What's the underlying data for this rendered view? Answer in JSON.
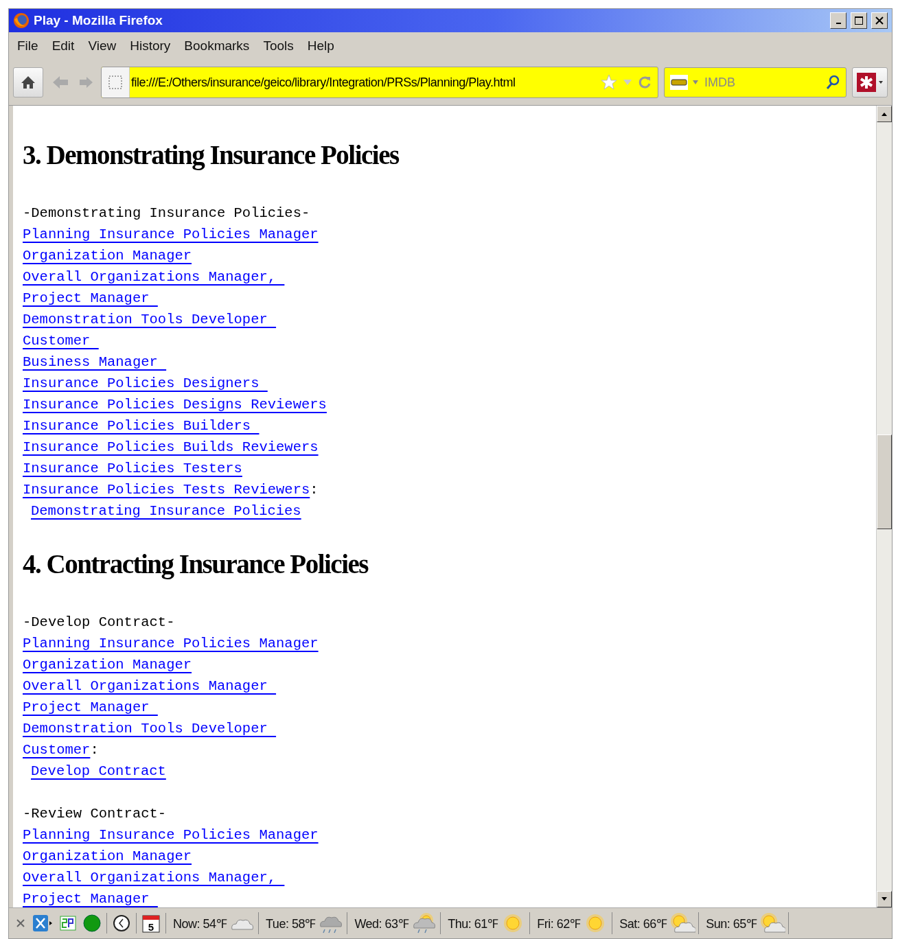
{
  "window": {
    "title": "Play - Mozilla Firefox"
  },
  "menu": [
    "File",
    "Edit",
    "View",
    "History",
    "Bookmarks",
    "Tools",
    "Help"
  ],
  "address_bar": {
    "value": "file:///E:/Others/insurance/geico/library/Integration/PRSs/Planning/Play.html"
  },
  "search": {
    "placeholder": "IMDB"
  },
  "sections": [
    {
      "heading": "3. Demonstrating Insurance Policies",
      "groups": [
        {
          "title": "-Demonstrating Insurance Policies-",
          "links": [
            {
              "text": "Planning Insurance Policies Manager"
            },
            {
              "text": "Organization Manager"
            },
            {
              "text": "Overall Organizations Manager, "
            },
            {
              "text": "Project Manager "
            },
            {
              "text": "Demonstration Tools Developer "
            },
            {
              "text": "Customer "
            },
            {
              "text": "Business Manager "
            },
            {
              "text": "Insurance Policies Designers "
            },
            {
              "text": "Insurance Policies Designs Reviewers"
            },
            {
              "text": "Insurance Policies Builders "
            },
            {
              "text": "Insurance Policies Builds Reviewers"
            },
            {
              "text": "Insurance Policies Testers"
            },
            {
              "text": "Insurance Policies Tests Reviewers",
              "suffix": ":"
            }
          ],
          "action": "Demonstrating Insurance Policies"
        }
      ]
    },
    {
      "heading": "4. Contracting Insurance Policies",
      "groups": [
        {
          "title": "-Develop Contract-",
          "links": [
            {
              "text": "Planning Insurance Policies Manager"
            },
            {
              "text": "Organization Manager"
            },
            {
              "text": "Overall Organizations Manager "
            },
            {
              "text": "Project Manager "
            },
            {
              "text": "Demonstration Tools Developer "
            },
            {
              "text": "Customer",
              "suffix": ":"
            }
          ],
          "action": "Develop Contract"
        },
        {
          "title": "-Review Contract-",
          "links": [
            {
              "text": "Planning Insurance Policies Manager"
            },
            {
              "text": "Organization Manager"
            },
            {
              "text": "Overall Organizations Manager, "
            },
            {
              "text": "Project Manager "
            }
          ]
        }
      ]
    }
  ],
  "status_bar": {
    "forecast": [
      {
        "label": "Now: 54℉",
        "kind": "cloudy"
      },
      {
        "label": "Tue: 58℉",
        "kind": "rain"
      },
      {
        "label": "Wed: 63℉",
        "kind": "sun-rain"
      },
      {
        "label": "Thu: 61℉",
        "kind": "sunny"
      },
      {
        "label": "Fri: 62℉",
        "kind": "sunny"
      },
      {
        "label": "Sat: 66℉",
        "kind": "partly-cloudy"
      },
      {
        "label": "Sun: 65℉",
        "kind": "partly-cloudy"
      }
    ],
    "calendar_day": "5"
  }
}
